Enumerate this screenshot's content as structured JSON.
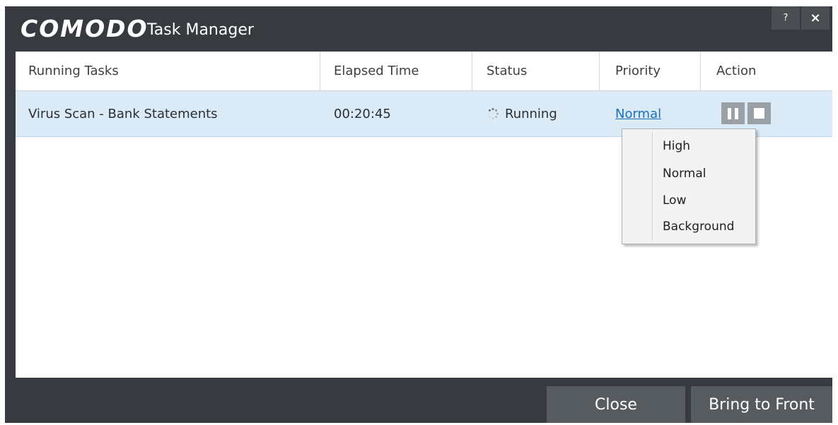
{
  "window": {
    "brand": "COMODO",
    "title": "Task Manager",
    "help_label": "?",
    "close_label": "×"
  },
  "table": {
    "columns": [
      "Running Tasks",
      "Elapsed Time",
      "Status",
      "Priority",
      "Action"
    ],
    "rows": [
      {
        "task": "Virus Scan - Bank Statements",
        "elapsed": "00:20:45",
        "status": "Running",
        "priority": "Normal"
      }
    ]
  },
  "priority_menu": {
    "options": [
      "High",
      "Normal",
      "Low",
      "Background"
    ]
  },
  "footer": {
    "close_label": "Close",
    "front_label": "Bring to Front"
  },
  "icons": {
    "status": "spinner-icon",
    "pause": "pause-icon",
    "stop": "stop-icon"
  },
  "colors": {
    "chrome": "#373b3f",
    "selected_row": "#dbeaf7",
    "link": "#1a6fbf",
    "footer_button": "#565b60"
  }
}
